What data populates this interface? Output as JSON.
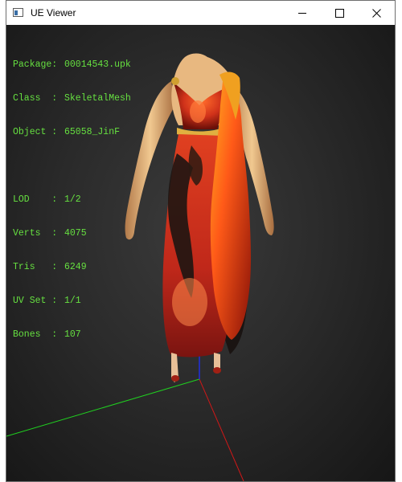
{
  "window": {
    "title": "UE Viewer"
  },
  "mesh_info": {
    "package": {
      "key": "Package:",
      "value": "00014543.upk"
    },
    "class": {
      "key": "Class  :",
      "value": "SkeletalMesh"
    },
    "object": {
      "key": "Object :",
      "value": "65058_JinF"
    },
    "lod": {
      "key": "LOD    :",
      "value": "1/2"
    },
    "verts": {
      "key": "Verts  :",
      "value": "4075"
    },
    "tris": {
      "key": "Tris   :",
      "value": "6249"
    },
    "uvset": {
      "key": "UV Set :",
      "value": "1/1"
    },
    "bones": {
      "key": "Bones  :",
      "value": "107"
    }
  },
  "colors": {
    "info_text": "#66e040",
    "axis_x": "#d01818",
    "axis_y": "#20d020",
    "axis_z": "#2030e0"
  },
  "icons": {
    "app": "window-icon",
    "minimize": "minimize-icon",
    "maximize": "maximize-icon",
    "close": "close-icon"
  }
}
